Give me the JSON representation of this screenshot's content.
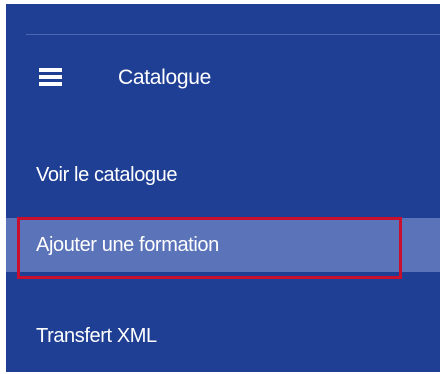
{
  "sidebar": {
    "section": {
      "icon": "list-icon",
      "title": "Catalogue"
    },
    "items": [
      {
        "label": "Voir le catalogue",
        "active": false
      },
      {
        "label": "Ajouter une formation",
        "active": true
      },
      {
        "label": "Transfert XML",
        "active": false
      }
    ]
  },
  "colors": {
    "sidebar_bg": "#1f3f94",
    "active_item_bg": "#5b73b9",
    "highlight_border": "#c8102e",
    "text": "#ffffff"
  }
}
